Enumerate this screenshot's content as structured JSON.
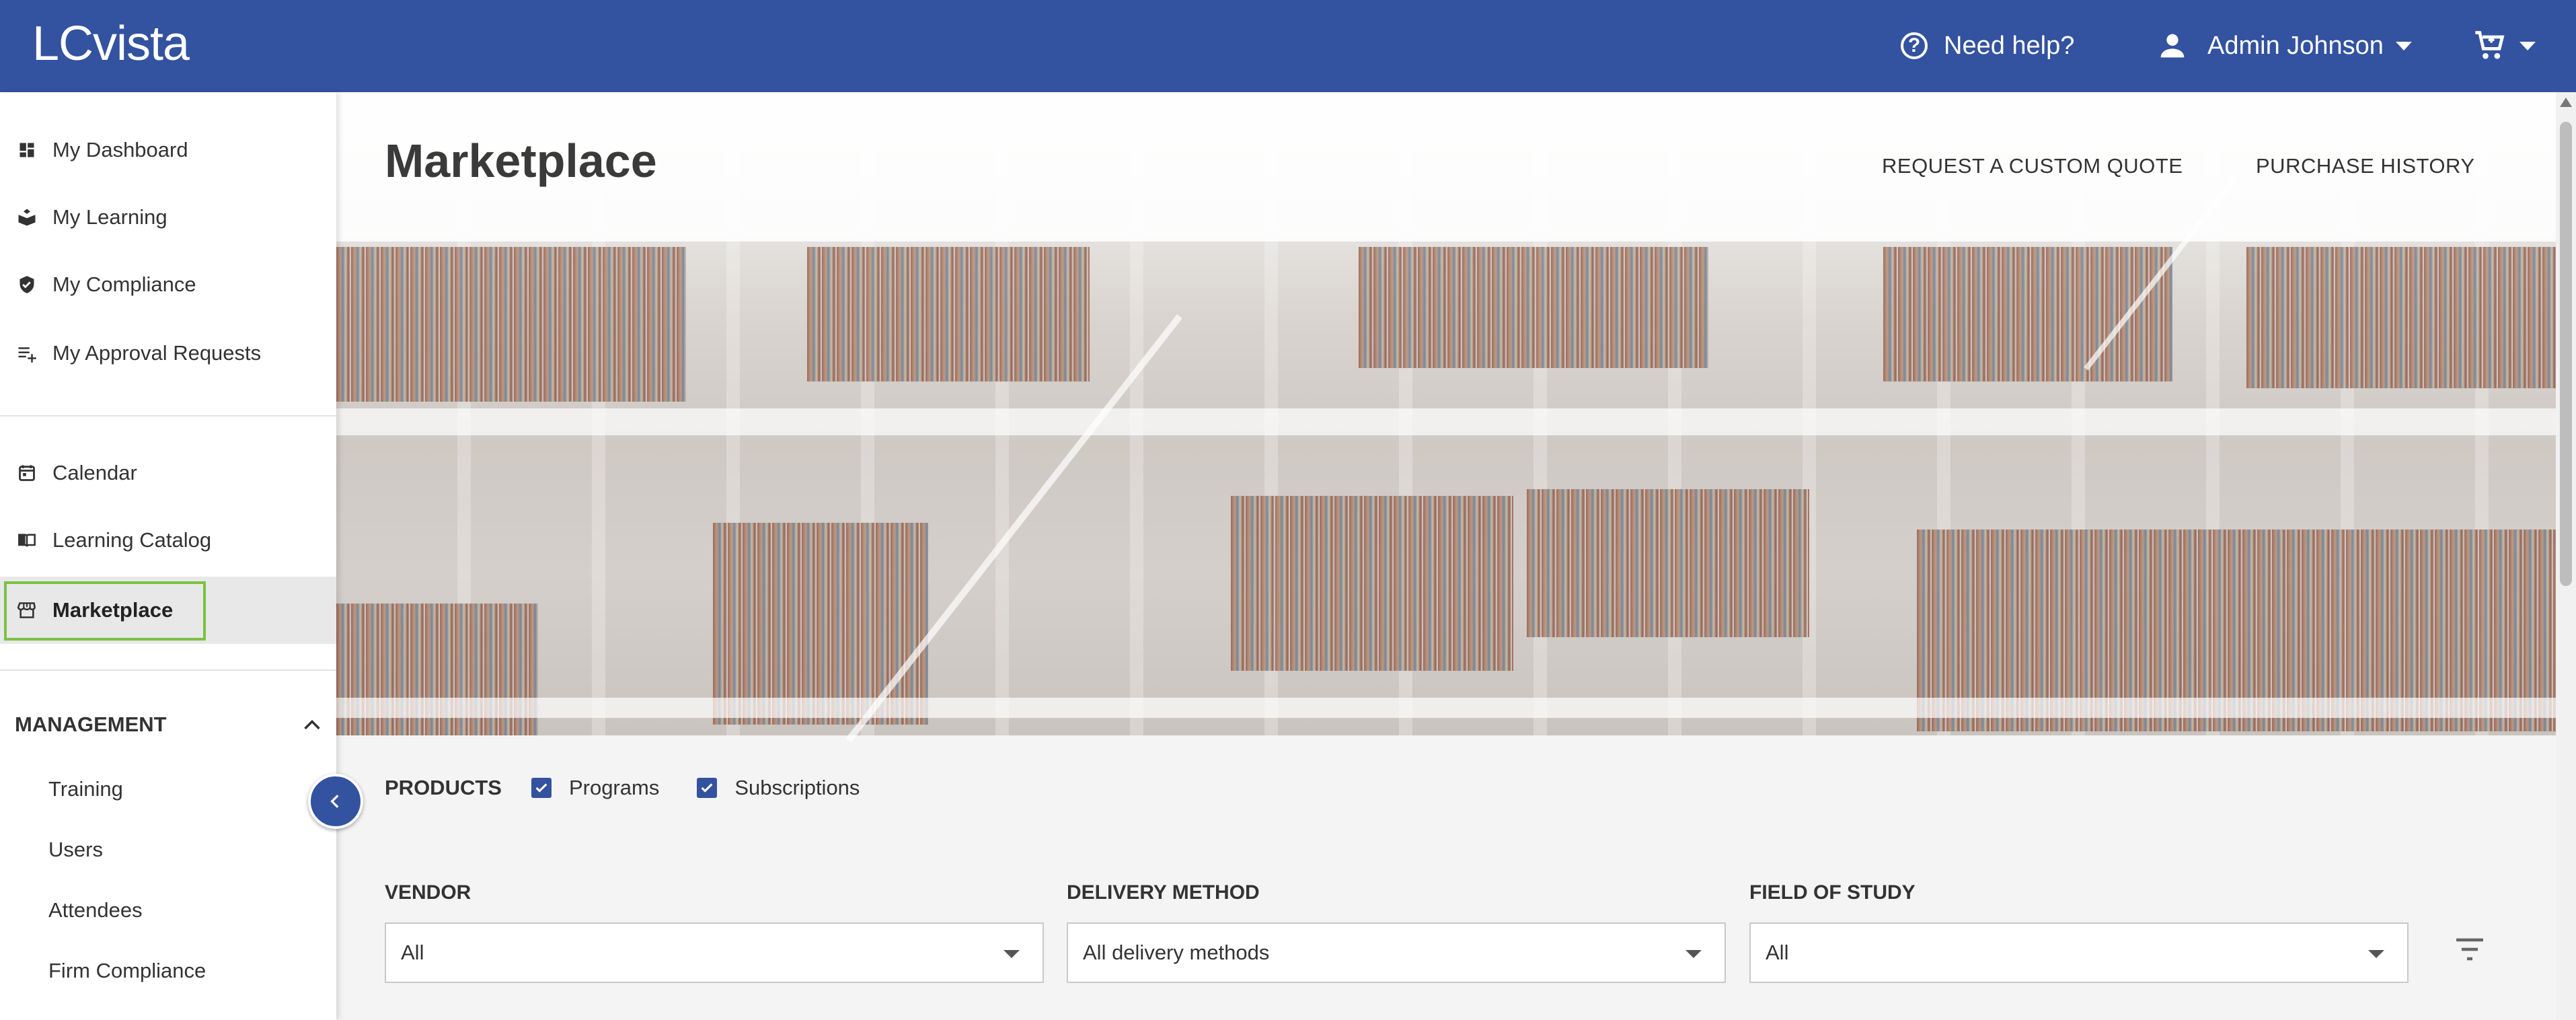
{
  "topbar": {
    "logo": "LCvista",
    "help_label": "Need help?",
    "user_label": "Admin Johnson"
  },
  "sidebar": {
    "items": [
      {
        "label": "My Dashboard",
        "icon": "dashboard-icon"
      },
      {
        "label": "My Learning",
        "icon": "learning-icon"
      },
      {
        "label": "My Compliance",
        "icon": "shield-check-icon"
      },
      {
        "label": "My Approval Requests",
        "icon": "playlist-add-icon"
      },
      {
        "label": "Calendar",
        "icon": "calendar-icon"
      },
      {
        "label": "Learning Catalog",
        "icon": "book-open-icon"
      },
      {
        "label": "Marketplace",
        "icon": "storefront-icon",
        "active": true
      }
    ],
    "management": {
      "label": "MANAGEMENT",
      "items": [
        "Training",
        "Users",
        "Attendees",
        "Firm Compliance"
      ]
    }
  },
  "main": {
    "title": "Marketplace",
    "links": [
      "REQUEST A CUSTOM QUOTE",
      "PURCHASE HISTORY"
    ],
    "products": {
      "label": "PRODUCTS",
      "options": [
        {
          "label": "Programs",
          "checked": true
        },
        {
          "label": "Subscriptions",
          "checked": true
        }
      ]
    },
    "filters": [
      {
        "label": "VENDOR",
        "value": "All"
      },
      {
        "label": "DELIVERY METHOD",
        "value": "All delivery methods"
      },
      {
        "label": "FIELD OF STUDY",
        "value": "All"
      }
    ]
  },
  "colors": {
    "brand": "#3352a0",
    "active_outline": "#7bc143"
  }
}
